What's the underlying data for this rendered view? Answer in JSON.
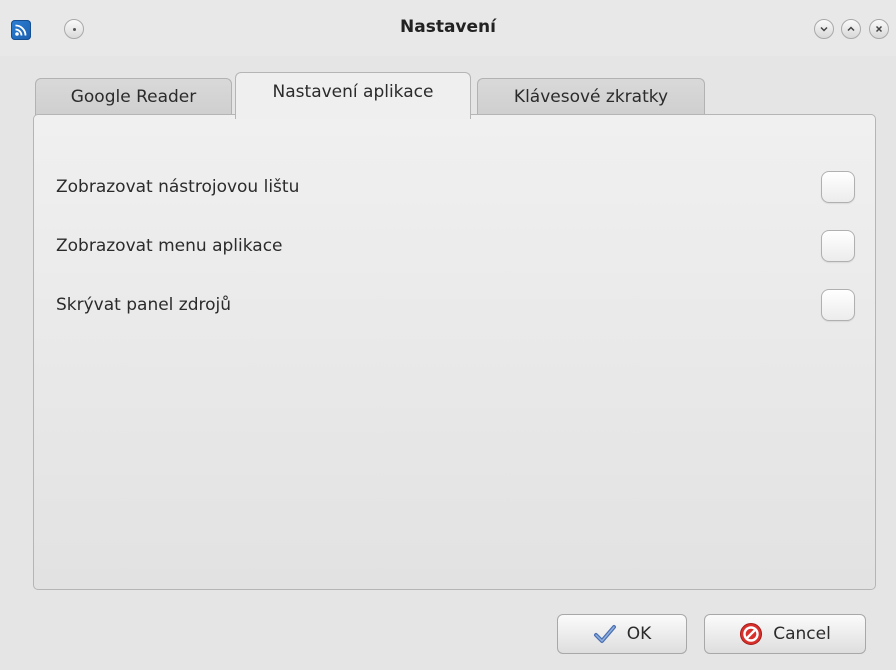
{
  "window": {
    "title": "Nastavení",
    "icons": {
      "app": "rss-feed-icon",
      "pin": "pin-dot-icon",
      "minimize": "chevron-down-icon",
      "maximize": "chevron-up-icon",
      "close": "close-icon"
    }
  },
  "tabs": [
    {
      "label": "Google Reader",
      "active": false
    },
    {
      "label": "Nastavení aplikace",
      "active": true
    },
    {
      "label": "Klávesové zkratky",
      "active": false
    }
  ],
  "options": [
    {
      "label": "Zobrazovat nástrojovou lištu",
      "checked": false
    },
    {
      "label": "Zobrazovat menu aplikace",
      "checked": false
    },
    {
      "label": "Skrývat panel zdrojů",
      "checked": false
    }
  ],
  "buttons": {
    "ok": {
      "label": "OK",
      "icon": "checkmark-icon"
    },
    "cancel": {
      "label": "Cancel",
      "icon": "cancel-circle-icon"
    }
  },
  "colors": {
    "window_bg": "#e5e5e5",
    "app_icon_blue": "#2c7fd6",
    "cancel_red": "#d9302c"
  }
}
